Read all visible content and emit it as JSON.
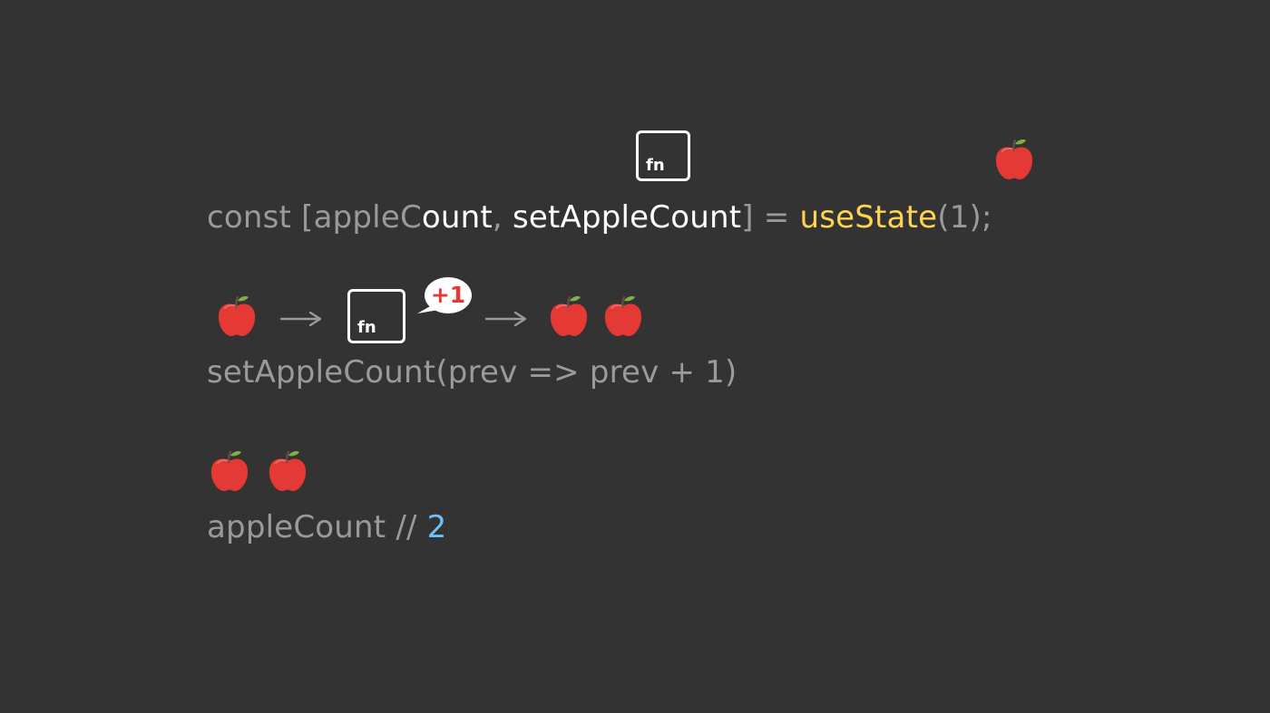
{
  "line1": {
    "const_kw": "const ",
    "bracket_open": "[",
    "apple_c": "appleC",
    "ount": "ount",
    "comma": ", ",
    "setter": "setAppleCount",
    "bracket_close": "]",
    "eq": " = ",
    "hook": "useState",
    "args": "(1);"
  },
  "line2": {
    "code": "setAppleCount(prev => prev + 1)"
  },
  "line3": {
    "var": "appleCount // ",
    "value": "2"
  },
  "fn_label": "fn",
  "bubble_label": "+1",
  "icons": {
    "apple": "red-apple-icon",
    "fn": "function-box-icon",
    "arrow": "right-arrow-icon",
    "bubble": "speech-bubble-icon"
  },
  "colors": {
    "background": "#333333",
    "code_gray": "#9a9a9a",
    "highlight_white": "#ffffff",
    "hook_yellow": "#ffd54f",
    "number_blue": "#6ec1f5",
    "apple_red": "#e53935",
    "bubble_text_red": "#e53935"
  }
}
